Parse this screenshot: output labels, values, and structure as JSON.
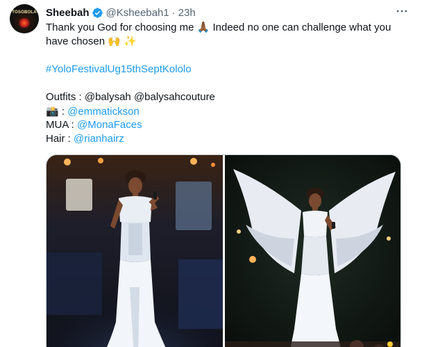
{
  "user": {
    "name": "Sheebah",
    "handle": "@Ksheebah1",
    "separator": "·",
    "time": "23h",
    "avatar_text": "TOSOBOLA",
    "verified_icon": "verified-badge-icon",
    "verified_color": "#1d9bf0"
  },
  "more_icon": "more-dots-icon",
  "tweet": {
    "line1": "Thank you God for choosing me 🙏🏾 Indeed no one can challenge what you",
    "line2": "have chosen 🙌 ✨",
    "hashtag": "#YoloFestivalUg15thSeptKololo",
    "outfits_label": "Outfits : @balysah @balysahcouture",
    "camera_emoji": "📸",
    "camera_sep": " : ",
    "camera_handle": "@emmatickson",
    "mua_label": "MUA : ",
    "mua_handle": "@MonaFaces",
    "hair_label": "Hair : ",
    "hair_handle": "@rianhairz"
  },
  "colors": {
    "link": "#1d9bf0",
    "text": "#0f1419",
    "muted": "#536471",
    "border": "#cfd9de"
  },
  "media": [
    {
      "name": "performer-white-gown-photo"
    },
    {
      "name": "performer-angel-wings-photo"
    }
  ]
}
